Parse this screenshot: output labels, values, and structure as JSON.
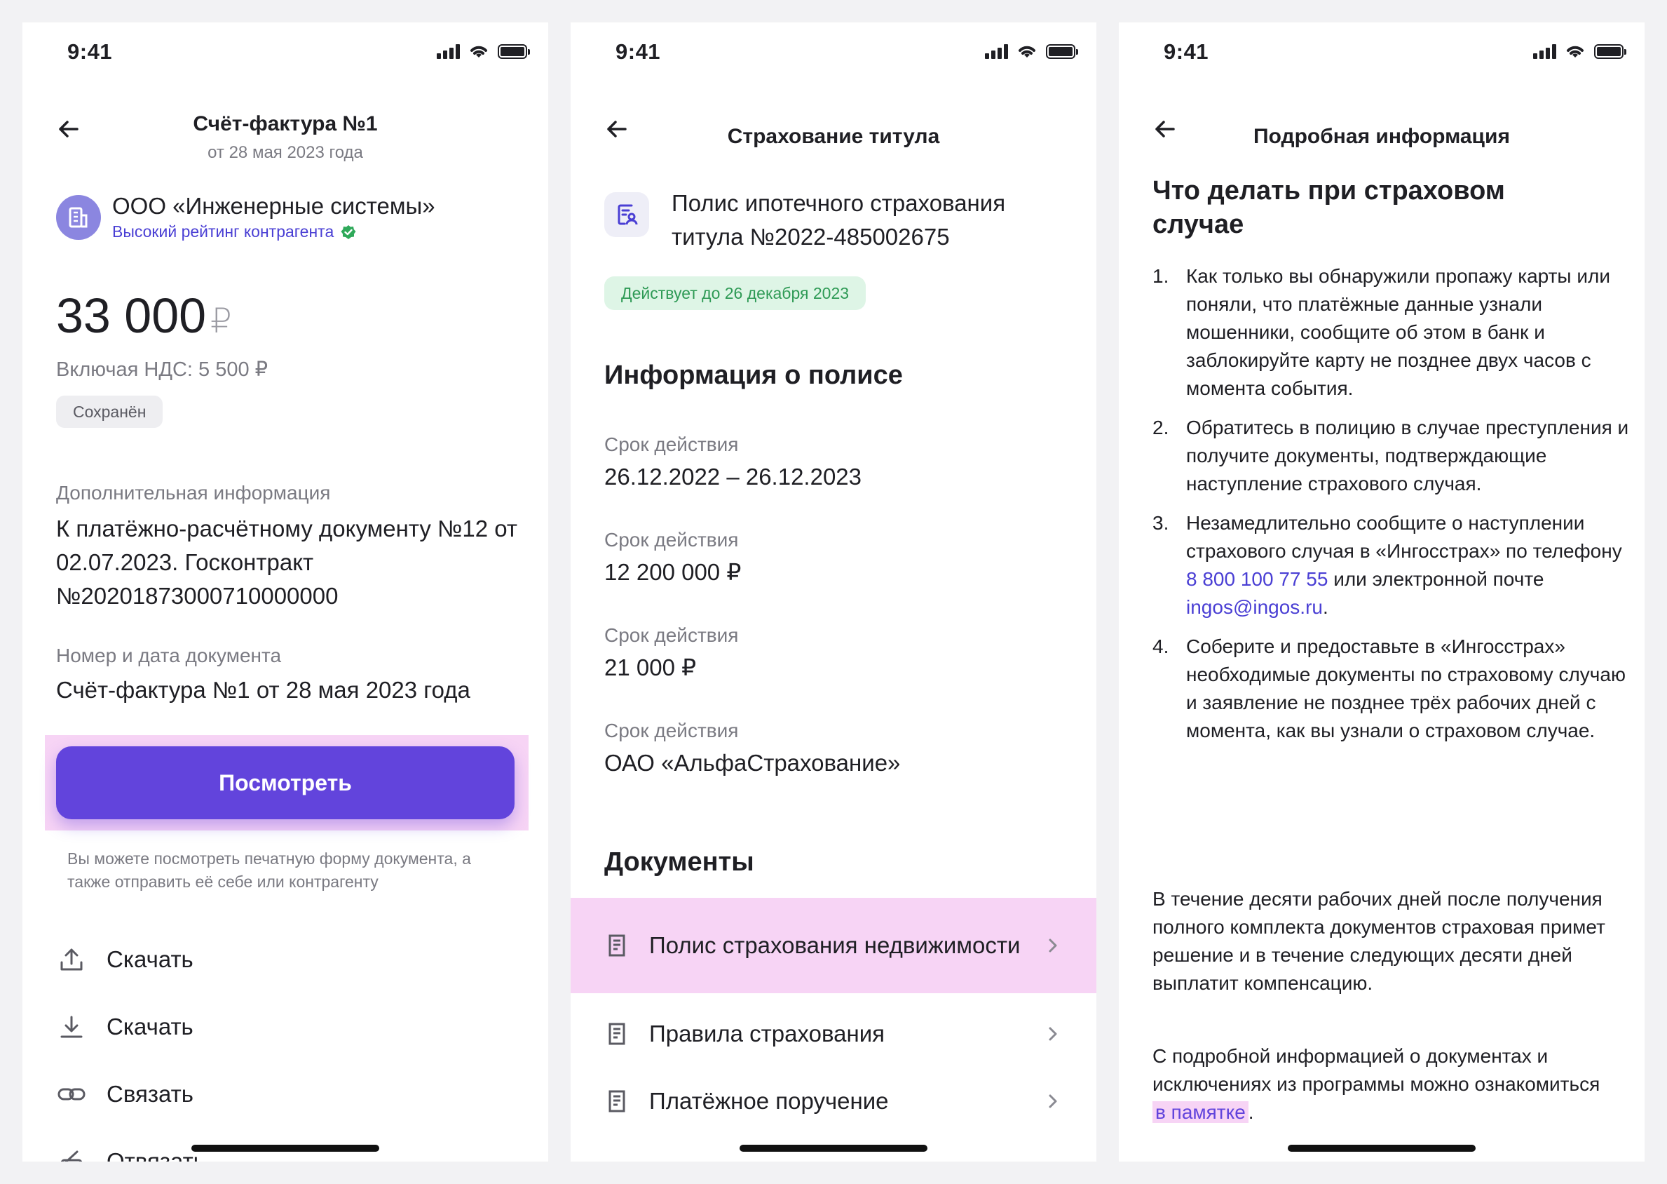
{
  "status_time": "9:41",
  "screen1": {
    "title": "Счёт-фактура №1",
    "subtitle": "от 28 мая 2023 года",
    "company_name": "ООО «Инженерные системы»",
    "company_rating": "Высокий рейтинг контрагента",
    "amount": "33 000",
    "currency": "₽",
    "vat": "Включая НДС: 5 500 ₽",
    "status": "Сохранён",
    "extra_label": "Дополнительная информация",
    "extra_value": "К платёжно-расчётному документу №12 от 02.07.2023. Госконтракт №2020187300071000000​0",
    "doc_label": "Номер и дата документа",
    "doc_value": "Счёт-фактура №1 от 28 мая 2023 года",
    "view_button": "Посмотреть",
    "hint": "Вы можете посмотреть печатную форму документа, а также отправить её себе или контрагенту",
    "actions": [
      "Скачать",
      "Скачать",
      "Связать",
      "Отвязать"
    ],
    "action_icons": [
      "share-upload-icon",
      "download-icon",
      "link-icon",
      "unlink-icon"
    ]
  },
  "screen2": {
    "title": "Страхование титула",
    "policy_title": "Полис ипотечного страхования титула №2022-485002675",
    "valid_badge": "Действует до 26 декабря 2023",
    "info_heading": "Информация о полисе",
    "fields": [
      {
        "label": "Срок действия",
        "value": "26.12.2022 – 26.12.2023"
      },
      {
        "label": "Срок действия",
        "value": "12 200 000 ₽"
      },
      {
        "label": "Срок действия",
        "value": "21 000 ₽"
      },
      {
        "label": "Срок действия",
        "value": "ОАО «АльфаСтрахование»"
      }
    ],
    "docs_heading": "Документы",
    "docs": [
      "Полис страхования недвижимости",
      "Правила страхования",
      "Платёжное поручение"
    ]
  },
  "screen3": {
    "title": "Подробная информация",
    "heading": "Что делать при страховом случае",
    "steps": [
      {
        "num": "1.",
        "text": "Как только вы обнаружили пропажу карты или поняли, что платёжные данные узнали мошенники, сообщите об этом в банк и заблокируйте карту не позднее двух часов с момента события."
      },
      {
        "num": "2.",
        "text": "Обратитесь в полицию в случае преступления и получите документы, подтверждающие наступление страхового случая."
      },
      {
        "num": "3.",
        "text_before": "Незамедлительно сообщите о наступлении страхового случая в «Ингосстрах» по телефону",
        "phone": "8 800 100 77 55",
        "text_mid": "или электронной почте",
        "email": "ingos@ingos.ru",
        "text_after": "."
      },
      {
        "num": "4.",
        "text": "Соберите и предоставьте в «Ингосстрах» необходимые документы по страховому случаю и заявление не позднее трёх рабочих дней с момента, как вы узнали о страховом случае."
      }
    ],
    "para1": "В течение десяти рабочих дней после получения полного комплекта документов страховая примет решение и в течение следующих десяти дней выплатит компенсацию.",
    "para2_before": "С подробной информацией о документах и исключениях из программы можно ознакомиться",
    "para2_link": "в памятке",
    "para2_after": "."
  },
  "colors": {
    "accent": "#6244dc",
    "link": "#4a3fd4",
    "highlight": "#f7d4f5",
    "success_bg": "#def5e6",
    "success_text": "#2e9a55"
  }
}
